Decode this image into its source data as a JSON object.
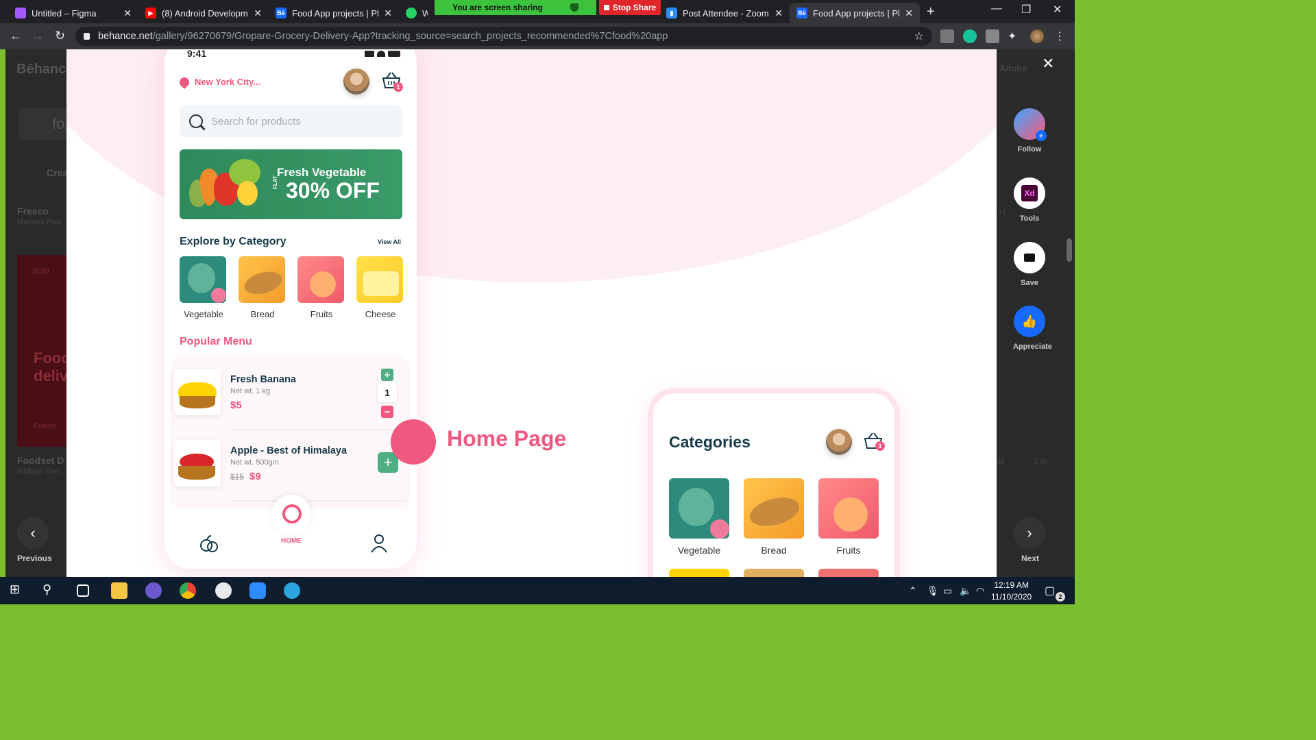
{
  "browser": {
    "tabs": [
      {
        "title": "Untitled – Figma",
        "favicon_color": "#a259ff"
      },
      {
        "title": "(8) Android Developme",
        "favicon_color": "#ff0000"
      },
      {
        "title": "Food App projects | Ph",
        "favicon_color": "#1769ff"
      },
      {
        "title": "Wh",
        "favicon_color": "#25d366"
      },
      {
        "title": "Post Attendee - Zoom",
        "favicon_color": "#2d8cff"
      },
      {
        "title": "Food App projects | Ph",
        "favicon_color": "#1769ff"
      }
    ],
    "active_tab_index": 5,
    "url": "behance.net/gallery/96270679/Gropare-Grocery-Delivery-App?tracking_source=search_projects_recommended%7Cfood%20app",
    "url_domain": "behance.net",
    "url_path": "/gallery/96270679/Gropare-Grocery-Delivery-App?tracking_source=search_projects_recommended%7Cfood%20app"
  },
  "zoom_share": {
    "status": "You are screen sharing",
    "stop_label": "Stop Share"
  },
  "behance_bg": {
    "logo": "Bēhance",
    "search_text": "fo",
    "create_label": "Crea",
    "card1_title": "Fresco",
    "card1_author": "Mariana Font",
    "card2_year": "2020",
    "card2_text": "Food deliv",
    "card2_tag": "Fusion",
    "card3_title": "Foodset D",
    "card3_author": "Multiple Own",
    "stat1": "31",
    "stat2": "38",
    "stat3": "3.9k"
  },
  "app": {
    "time": "9:41",
    "location": "New York City...",
    "cart_count": "1",
    "search_placeholder": "Search for products",
    "banner": {
      "title": "Fresh Vegetable",
      "flat": "FLAT",
      "offer": "30% OFF"
    },
    "explore_title": "Explore by Category",
    "view_all": "View All",
    "categories": [
      "Vegetable",
      "Bread",
      "Fruits",
      "Cheese"
    ],
    "popular_title": "Popular Menu",
    "items": [
      {
        "name": "Fresh Banana",
        "weight": "Net wt. 1 kg",
        "price": "$5",
        "qty": "1"
      },
      {
        "name": "Apple - Best of Himalaya",
        "weight": "Net wt. 500gm",
        "old_price": "$15",
        "price": "$9"
      }
    ],
    "home_label": "HOME"
  },
  "project": {
    "caption": "Home Page",
    "second_screen_title": "Categories",
    "second_cart_count": "1",
    "second_categories": [
      "Vegetable",
      "Bread",
      "Fruits"
    ]
  },
  "rail": {
    "follow": "Follow",
    "tools": "Tools",
    "tools_badge": "Xd",
    "save": "Save",
    "appreciate": "Appreciate",
    "previous": "Previous",
    "next": "Next",
    "adobe": "Adobe"
  },
  "taskbar": {
    "time": "12:19 AM",
    "date": "11/10/2020",
    "notif_count": "2"
  }
}
